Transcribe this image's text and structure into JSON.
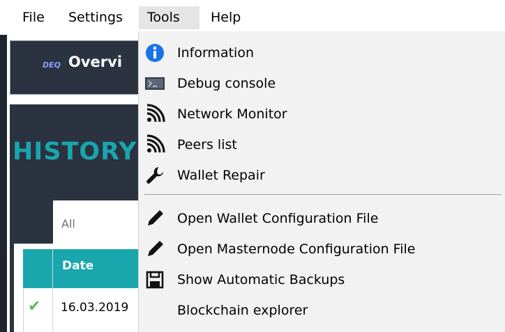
{
  "menubar": {
    "items": [
      {
        "label": "File"
      },
      {
        "label": "Settings"
      },
      {
        "label": "Tools"
      },
      {
        "label": "Help"
      }
    ]
  },
  "app": {
    "logo_text": "DEQ",
    "overview_label": "Overvi",
    "history_title": "HISTORY",
    "filter_value": "All",
    "table": {
      "header_date": "Date",
      "rows": [
        {
          "date": "16.03.2019",
          "status_icon": "checkmark-icon"
        }
      ]
    }
  },
  "tools_menu": {
    "items": [
      {
        "label": "Information",
        "icon": "info-icon"
      },
      {
        "label": "Debug console",
        "icon": "console-icon"
      },
      {
        "label": "Network Monitor",
        "icon": "signal-icon"
      },
      {
        "label": "Peers list",
        "icon": "signal-icon"
      },
      {
        "label": "Wallet Repair",
        "icon": "wrench-icon"
      },
      {
        "label": "Open Wallet Configuration File",
        "icon": "pencil-icon"
      },
      {
        "label": "Open Masternode Configuration File",
        "icon": "pencil-icon"
      },
      {
        "label": "Show Automatic Backups",
        "icon": "floppy-icon"
      },
      {
        "label": "Blockchain explorer",
        "icon": ""
      }
    ]
  },
  "colors": {
    "accent": "#19a6ad",
    "panel": "#2b3240",
    "menu_bg": "#f2f2f2",
    "info_blue": "#1a73e8",
    "check_green": "#5cb85c"
  }
}
